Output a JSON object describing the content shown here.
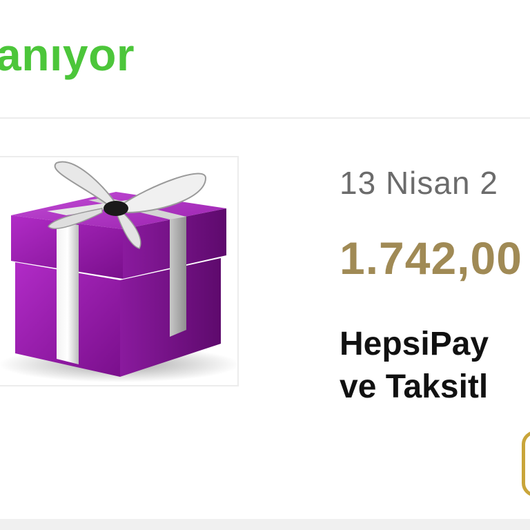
{
  "status": {
    "text": "anıyor",
    "color": "#4cc63a"
  },
  "order": {
    "product_image_icon": "gift-box-icon",
    "date": "13 Nisan 2",
    "price": "1.742,00",
    "title_lines": [
      "HepsiPay",
      "ve Taksitl"
    ],
    "price_color": "#a08a55"
  }
}
